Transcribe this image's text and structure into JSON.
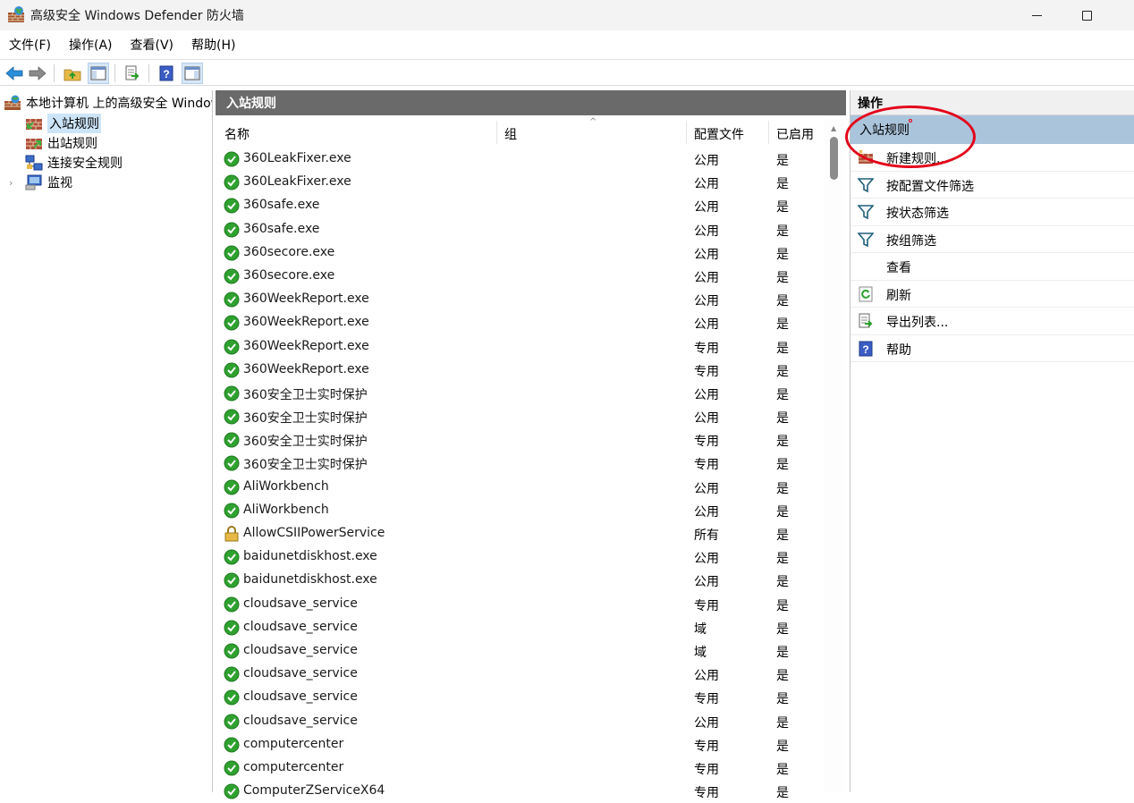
{
  "window": {
    "title": "高级安全 Windows Defender 防火墙",
    "app_icon": "firewall-icon"
  },
  "menu": [
    "文件(F)",
    "操作(A)",
    "查看(V)",
    "帮助(H)"
  ],
  "toolbar": {
    "buttons": [
      "back-arrow-icon",
      "forward-arrow-icon",
      "up-folder-icon",
      "show-hide-tree-icon",
      "export-list-icon",
      "help-icon",
      "show-hide-action-pane-icon"
    ]
  },
  "tree": {
    "root": "本地计算机 上的高级安全 Windows Defender 防火墙",
    "items": [
      "入站规则",
      "出站规则",
      "连接安全规则",
      "监视"
    ],
    "selected": "入站规则"
  },
  "main": {
    "header": "入站规则",
    "columns": [
      "名称",
      "组",
      "配置文件",
      "已启用"
    ],
    "rows": [
      {
        "name": "360LeakFixer.exe",
        "profile": "公用",
        "enabled": "是",
        "icon": "allow-check-icon"
      },
      {
        "name": "360LeakFixer.exe",
        "profile": "公用",
        "enabled": "是",
        "icon": "allow-check-icon"
      },
      {
        "name": "360safe.exe",
        "profile": "公用",
        "enabled": "是",
        "icon": "allow-check-icon"
      },
      {
        "name": "360safe.exe",
        "profile": "公用",
        "enabled": "是",
        "icon": "allow-check-icon"
      },
      {
        "name": "360secore.exe",
        "profile": "公用",
        "enabled": "是",
        "icon": "allow-check-icon"
      },
      {
        "name": "360secore.exe",
        "profile": "公用",
        "enabled": "是",
        "icon": "allow-check-icon"
      },
      {
        "name": "360WeekReport.exe",
        "profile": "公用",
        "enabled": "是",
        "icon": "allow-check-icon"
      },
      {
        "name": "360WeekReport.exe",
        "profile": "公用",
        "enabled": "是",
        "icon": "allow-check-icon"
      },
      {
        "name": "360WeekReport.exe",
        "profile": "专用",
        "enabled": "是",
        "icon": "allow-check-icon"
      },
      {
        "name": "360WeekReport.exe",
        "profile": "专用",
        "enabled": "是",
        "icon": "allow-check-icon"
      },
      {
        "name": "360安全卫士实时保护",
        "profile": "公用",
        "enabled": "是",
        "icon": "allow-check-icon"
      },
      {
        "name": "360安全卫士实时保护",
        "profile": "公用",
        "enabled": "是",
        "icon": "allow-check-icon"
      },
      {
        "name": "360安全卫士实时保护",
        "profile": "专用",
        "enabled": "是",
        "icon": "allow-check-icon"
      },
      {
        "name": "360安全卫士实时保护",
        "profile": "专用",
        "enabled": "是",
        "icon": "allow-check-icon"
      },
      {
        "name": "AliWorkbench",
        "profile": "公用",
        "enabled": "是",
        "icon": "allow-check-icon"
      },
      {
        "name": "AliWorkbench",
        "profile": "公用",
        "enabled": "是",
        "icon": "allow-check-icon"
      },
      {
        "name": "AllowCSIIPowerService",
        "profile": "所有",
        "enabled": "是",
        "icon": "lock-icon"
      },
      {
        "name": "baidunetdiskhost.exe",
        "profile": "公用",
        "enabled": "是",
        "icon": "allow-check-icon"
      },
      {
        "name": "baidunetdiskhost.exe",
        "profile": "公用",
        "enabled": "是",
        "icon": "allow-check-icon"
      },
      {
        "name": "cloudsave_service",
        "profile": "专用",
        "enabled": "是",
        "icon": "allow-check-icon"
      },
      {
        "name": "cloudsave_service",
        "profile": "域",
        "enabled": "是",
        "icon": "allow-check-icon"
      },
      {
        "name": "cloudsave_service",
        "profile": "域",
        "enabled": "是",
        "icon": "allow-check-icon"
      },
      {
        "name": "cloudsave_service",
        "profile": "公用",
        "enabled": "是",
        "icon": "allow-check-icon"
      },
      {
        "name": "cloudsave_service",
        "profile": "专用",
        "enabled": "是",
        "icon": "allow-check-icon"
      },
      {
        "name": "cloudsave_service",
        "profile": "公用",
        "enabled": "是",
        "icon": "allow-check-icon"
      },
      {
        "name": "computercenter",
        "profile": "专用",
        "enabled": "是",
        "icon": "allow-check-icon"
      },
      {
        "name": "computercenter",
        "profile": "专用",
        "enabled": "是",
        "icon": "allow-check-icon"
      },
      {
        "name": "ComputerZServiceX64",
        "profile": "专用",
        "enabled": "是",
        "icon": "allow-check-icon"
      }
    ]
  },
  "actions": {
    "header": "操作",
    "section": "入站规则",
    "items": [
      {
        "label": "新建规则...",
        "icon": "new-rule-icon"
      },
      {
        "label": "按配置文件筛选",
        "icon": "filter-icon"
      },
      {
        "label": "按状态筛选",
        "icon": "filter-icon"
      },
      {
        "label": "按组筛选",
        "icon": "filter-icon"
      },
      {
        "label": "查看",
        "icon": ""
      },
      {
        "label": "刷新",
        "icon": "refresh-icon"
      },
      {
        "label": "导出列表...",
        "icon": "export-list-icon"
      },
      {
        "label": "帮助",
        "icon": "help-icon"
      }
    ]
  },
  "colors": {
    "panel_header": "#6a6a6a",
    "action_section": "#aac4dc",
    "selection": "#cce4f7",
    "annotation": "#e3061b"
  }
}
